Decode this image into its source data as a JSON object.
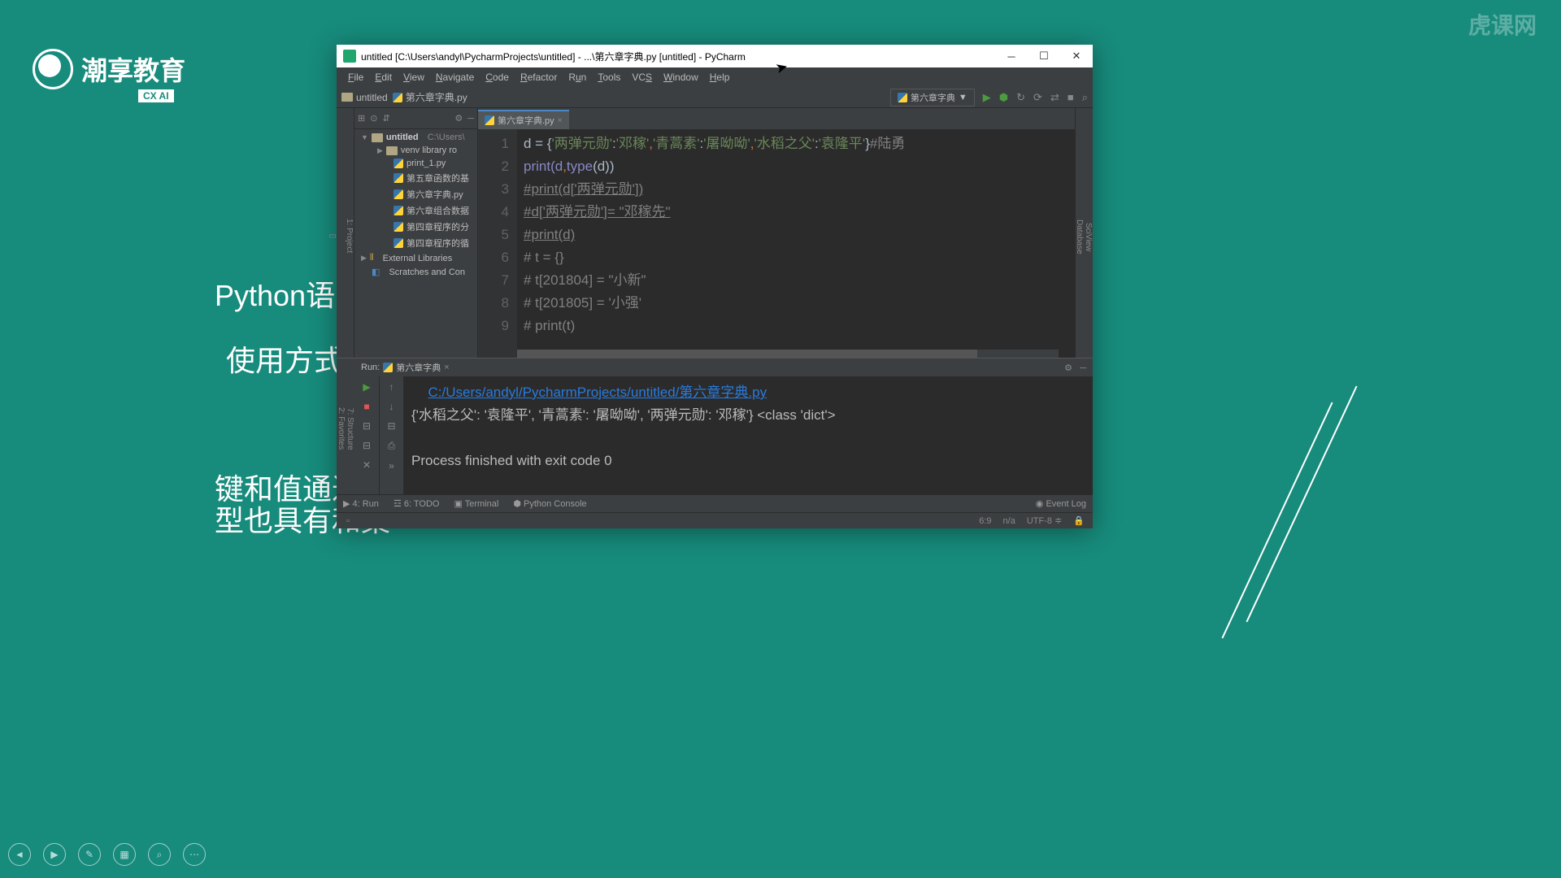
{
  "logo": {
    "brand": "潮享教育",
    "sub": "CX AI"
  },
  "watermark": "虎课网",
  "bg": {
    "t1": "Python语言",
    "t2": "使用方式：",
    "t3": "键和值通过冒",
    "t4": "型也具有和集"
  },
  "window": {
    "title": "untitled [C:\\Users\\andyl\\PycharmProjects\\untitled] - ...\\第六章字典.py [untitled] - PyCharm",
    "menu": [
      "File",
      "Edit",
      "View",
      "Navigate",
      "Code",
      "Refactor",
      "Run",
      "Tools",
      "VCS",
      "Window",
      "Help"
    ],
    "crumb1": "untitled",
    "crumb2": "第六章字典.py",
    "run_config": "第六章字典",
    "tab": "第六章字典.py",
    "tree": {
      "root": "untitled",
      "root_path": "C:\\Users\\",
      "venv": "venv library ro",
      "files": [
        "print_1.py",
        "第五章函数的基",
        "第六章字典.py",
        "第六章组合数据",
        "第四章程序的分",
        "第四章程序的循"
      ],
      "ext": "External Libraries",
      "scratch": "Scratches and Con"
    },
    "code": {
      "lines": [
        "1",
        "2",
        "3",
        "4",
        "5",
        "6",
        "7",
        "8",
        "9"
      ],
      "l1a": "d = {",
      "l1s1": "'两弹元勋'",
      "l1c": ":",
      "l1s2": "'邓稼'",
      "l1d": ",",
      "l1s3": "'青蒿素'",
      "l1e": ":",
      "l1s4": "'屠呦呦'",
      "l1f": ",",
      "l1s5": "'水稻之父'",
      "l1g": ":",
      "l1s6": "'袁隆平'",
      "l1h": "}",
      "l1cm": "#陆勇",
      "l2a": "print(d",
      "l2b": ",",
      "l2c": "type",
      "l2d": "(d))",
      "l3": "#print(d['两弹元勋'])",
      "l4": "#d['两弹元勋']= \"邓稼先\"",
      "l5": "#print(d)",
      "l6": "# t = {}",
      "l7": "# t[201804] = \"小新\"",
      "l8": "# t[201805] = '小强'",
      "l9": "# print(t)"
    },
    "run": {
      "label": "Run:",
      "tab": "第六章字典",
      "path": "C:/Users/andyl/PycharmProjects/untitled/第六章字典.py",
      "out": "{'水稻之父': '袁隆平', '青蒿素': '屠呦呦', '两弹元勋': '邓稼'} <class 'dict'>",
      "exit": "Process finished with exit code 0"
    },
    "bottom": {
      "run": "4: Run",
      "todo": "6: TODO",
      "term": "Terminal",
      "py": "Python Console",
      "ev": "Event Log"
    },
    "status": {
      "pos": "6:9",
      "na": "n/a",
      "enc": "UTF-8"
    },
    "rails": {
      "project": "1: Project",
      "structure": "7: Structure",
      "fav": "2: Favorites",
      "sci": "SciView",
      "db": "Database"
    }
  }
}
